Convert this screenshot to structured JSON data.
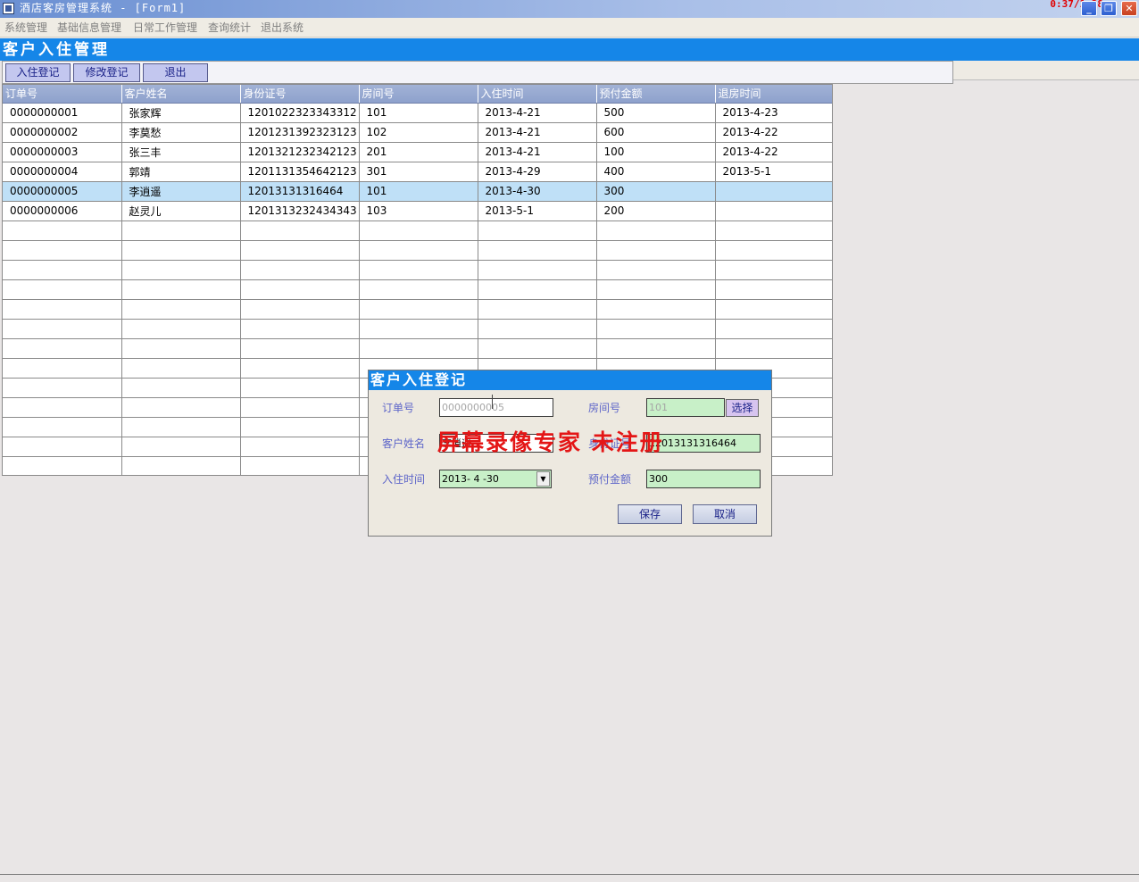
{
  "window": {
    "title": "酒店客房管理系统 - [Form1]",
    "clock": "0:37/1:38",
    "min_glyph": "_",
    "restore_glyph": "❐",
    "close_glyph": "✕"
  },
  "menu": [
    "系统管理",
    "基础信息管理",
    "日常工作管理",
    "查询统计",
    "退出系统"
  ],
  "form": {
    "title": "客户入住管理"
  },
  "toolbar": {
    "checkin_label": "入住登记",
    "modify_label": "修改登记",
    "exit_label": "退出"
  },
  "grid": {
    "columns": [
      "订单号",
      "客户姓名",
      "身份证号",
      "房间号",
      "入住时间",
      "预付金额",
      "退房时间"
    ],
    "rows": [
      [
        "0000000001",
        "张家辉",
        "1201022323343312",
        "101",
        "2013-4-21",
        "500",
        "2013-4-23"
      ],
      [
        "0000000002",
        "李莫愁",
        "1201231392323123",
        "102",
        "2013-4-21",
        "600",
        "2013-4-22"
      ],
      [
        "0000000003",
        "张三丰",
        "1201321232342123",
        "201",
        "2013-4-21",
        "100",
        "2013-4-22"
      ],
      [
        "0000000004",
        "郭靖",
        "1201131354642123",
        "301",
        "2013-4-29",
        "400",
        "2013-5-1"
      ],
      [
        "0000000005",
        "李逍遥",
        "12013131316464",
        "101",
        "2013-4-30",
        "300",
        ""
      ],
      [
        "0000000006",
        "赵灵儿",
        "1201313232434343",
        "103",
        "2013-5-1",
        "200",
        ""
      ]
    ],
    "selected_row": 5,
    "empty_rows": 13
  },
  "dialog": {
    "title": "客户入住登记",
    "order_no_label": "订单号",
    "order_no_value": "0000000005",
    "room_label": "房间号",
    "room_value": "101",
    "select_label": "选择",
    "name_label": "客户姓名",
    "name_value": "李逍遥",
    "id_label": "身份证号",
    "id_value": "12013131316464",
    "checkin_label": "入住时间",
    "checkin_value": "2013- 4 -30",
    "deposit_label": "预付金额",
    "deposit_value": "300",
    "save_label": "保存",
    "cancel_label": "取消",
    "dropdown_glyph": "▼"
  },
  "watermark": "屏幕录像专家 未注册",
  "colors": {
    "header_blue": "#1586e8",
    "grid_header": "#8ea1cc",
    "selected_row": "#bfe0f7",
    "input_green": "#c8f0c8",
    "watermark_red": "#e41616"
  }
}
